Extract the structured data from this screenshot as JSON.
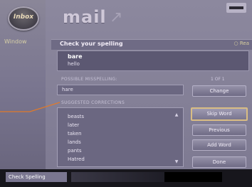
{
  "rail": {
    "logo_text": "Inbox",
    "menu_label": "Window"
  },
  "app": {
    "title": "mail",
    "title_deco": "↗"
  },
  "header": {
    "title": "Check your spelling",
    "option": "○ Rea"
  },
  "word": {
    "line1": "bare",
    "line2": "hello"
  },
  "misspelling": {
    "label": "POSSIBLE MISSPELLING:",
    "page_indicator": "1 OF 1",
    "value": "hare",
    "change_button": "Change"
  },
  "corrections": {
    "label": "SUGGESTED CORRECTIONS",
    "items": [
      "beasts",
      "later",
      "taken",
      "lands",
      "pants",
      "Hatred"
    ]
  },
  "buttons": {
    "skip_word": "Skip Word",
    "previous": "Previous",
    "add_word": "Add Word",
    "done": "Done"
  },
  "status": {
    "label": "Check Spelling",
    "progress": 0.62
  }
}
